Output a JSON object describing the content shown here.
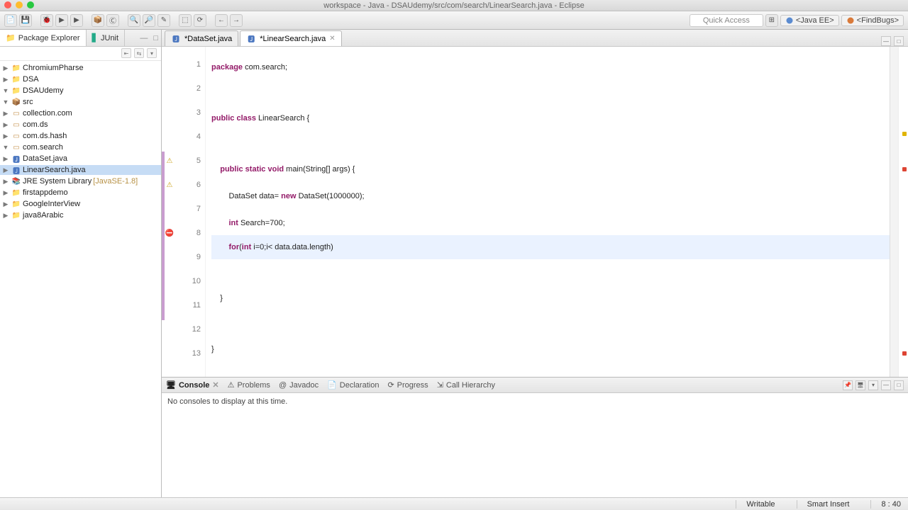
{
  "title": "workspace - Java - DSAUdemy/src/com/search/LinearSearch.java - Eclipse",
  "quick_access": "Quick Access",
  "perspectives": {
    "p1": "<Java EE>",
    "p2": "<FindBugs>"
  },
  "left_panel": {
    "tabs": {
      "explorer": "Package Explorer",
      "junit": "JUnit"
    },
    "items": {
      "chromium": "ChromiumPharse",
      "dsa": "DSA",
      "dsaud": "DSAUdemy",
      "src": "src",
      "pkg_coll": "collection.com",
      "pkg_ds": "com.ds",
      "pkg_hash": "com.ds.hash",
      "pkg_search": "com.search",
      "f_dataset": "DataSet.java",
      "f_linear": "LinearSearch.java",
      "jre": "JRE System Library",
      "jre_ver": "[JavaSE-1.8]",
      "firstapp": "firstappdemo",
      "goog": "GoogleInterView",
      "java8": "java8Arabic"
    }
  },
  "editor": {
    "tabs": {
      "t1": "*DataSet.java",
      "t2": "*LinearSearch.java"
    },
    "lines": [
      "1",
      "2",
      "3",
      "4",
      "5",
      "6",
      "7",
      "8",
      "9",
      "10",
      "11",
      "12",
      "13"
    ],
    "code": {
      "l1a": "package",
      "l1b": " com.search;",
      "l3a": "public",
      "l3b": " class",
      "l3c": " LinearSearch {",
      "l5a": "    public",
      "l5b": " static",
      "l5c": " void",
      "l5d": " main(String[] args) {",
      "l6a": "        DataSet data= ",
      "l6b": "new",
      "l6c": " DataSet(1000000);",
      "l7a": "        int",
      "l7b": " Search=700;",
      "l8a": "        for",
      "l8b": "(",
      "l8c": "int",
      "l8d": " i=0;i< data.data.length)",
      "l10": "    }",
      "l12": "}"
    }
  },
  "console": {
    "tabs": {
      "console": "Console",
      "problems": "Problems",
      "javadoc": "Javadoc",
      "decl": "Declaration",
      "prog": "Progress",
      "ch": "Call Hierarchy"
    },
    "empty": "No consoles to display at this time."
  },
  "status": {
    "writable": "Writable",
    "insert": "Smart Insert",
    "pos": "8 : 40"
  }
}
